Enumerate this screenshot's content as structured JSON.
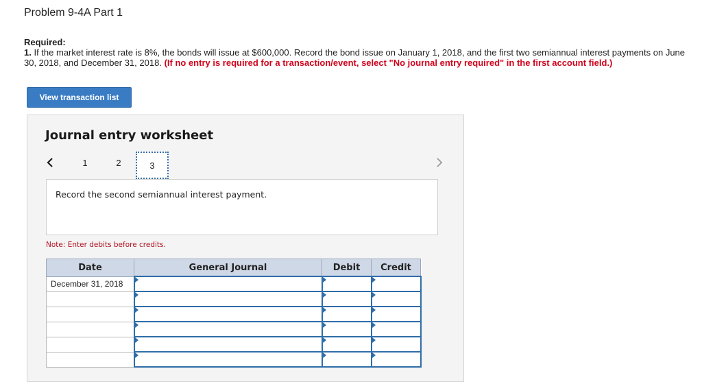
{
  "header": {
    "title": "Problem 9-4A Part 1",
    "required_label": "Required:",
    "item_number": "1.",
    "instruction_text": "If the market interest rate is 8%, the bonds will issue at $600,000. Record the bond issue on January 1, 2018, and the first two semiannual interest payments on June 30, 2018, and December 31, 2018.",
    "instruction_note": "(If no entry is required for a transaction/event, select \"No journal entry required\" in the first account field.)"
  },
  "view_transactions_label": "View transaction list",
  "worksheet": {
    "title": "Journal entry worksheet",
    "pages": [
      "1",
      "2",
      "3"
    ],
    "current_page": "3",
    "prev_glyph": "‹",
    "next_glyph": "›",
    "description": "Record the second semiannual interest payment.",
    "note": "Note: Enter debits before credits.",
    "columns": {
      "date": "Date",
      "general_journal": "General Journal",
      "debit": "Debit",
      "credit": "Credit"
    },
    "rows": [
      {
        "date": "December 31, 2018"
      },
      {
        "date": ""
      },
      {
        "date": ""
      },
      {
        "date": ""
      },
      {
        "date": ""
      },
      {
        "date": ""
      }
    ]
  }
}
